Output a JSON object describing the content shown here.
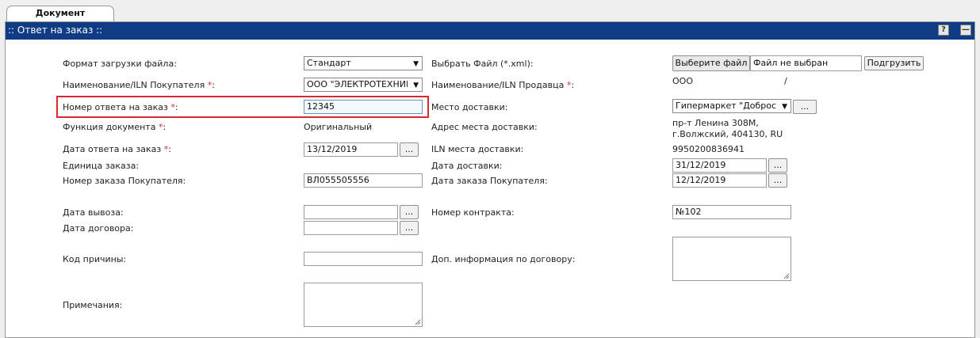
{
  "tabs": {
    "document": "Документ"
  },
  "panel": {
    "title": ":: Ответ на заказ ::",
    "help_label": "?",
    "minimize_label": "—"
  },
  "form": {
    "file_format": {
      "label": "Формат загрузки файла:",
      "value": "Стандарт"
    },
    "choose_file": {
      "label": "Выбрать Файл (*.xml):",
      "button": "Выберите файл",
      "status": "Файл не выбран",
      "upload": "Подгрузить"
    },
    "buyer": {
      "label": "Наименование/ILN Покупателя",
      "value": "ООО \"ЭЛЕКТРОТЕХНИКА\""
    },
    "seller": {
      "label": "Наименование/ILN Продавца",
      "value": "ООО",
      "slash": "/"
    },
    "response_number": {
      "label": "Номер ответа на заказ",
      "value": "12345"
    },
    "delivery_place": {
      "label": "Место доставки:",
      "value": "Гипермаркет \"Добросток\"",
      "button": "..."
    },
    "doc_function": {
      "label": "Функция документа",
      "value": "Оригинальный"
    },
    "delivery_address": {
      "label": "Адрес места доставки:",
      "line1": "пр-т Ленина 308М,",
      "line2": "г.Волжский, 404130, RU"
    },
    "response_date": {
      "label": "Дата ответа на заказ",
      "value": "13/12/2019",
      "button": "..."
    },
    "delivery_iln": {
      "label": "ILN места доставки:",
      "value": "9950200836941"
    },
    "order_unit": {
      "label": "Единица заказа:"
    },
    "delivery_date": {
      "label": "Дата доставки:",
      "value": "31/12/2019",
      "button": "..."
    },
    "buyer_order_number": {
      "label": "Номер заказа Покупателя:",
      "value": "ВЛ055505556"
    },
    "buyer_order_date": {
      "label": "Дата заказа Покупателя:",
      "value": "12/12/2019",
      "button": "..."
    },
    "pickup_date": {
      "label": "Дата вывоза:",
      "value": "",
      "button": "..."
    },
    "contract_number": {
      "label": "Номер контракта:",
      "value": "№102"
    },
    "contract_date": {
      "label": "Дата договора:",
      "value": "",
      "button": "..."
    },
    "reason_code": {
      "label": "Код причины:",
      "value": ""
    },
    "contract_info": {
      "label": "Доп. информация по договору:"
    },
    "notes": {
      "label": "Примечания:"
    },
    "required_mark": "*"
  }
}
